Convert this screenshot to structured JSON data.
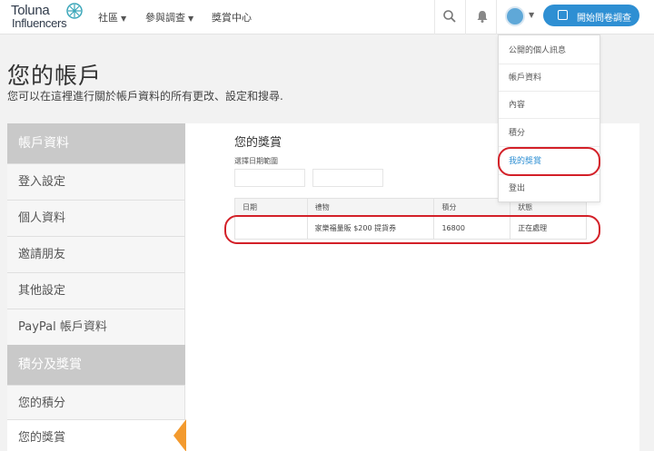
{
  "brand": {
    "logo_line1": "Toluna",
    "logo_line2": "Influencers"
  },
  "nav": {
    "items": [
      {
        "label": "社區",
        "has_dropdown": true
      },
      {
        "label": "參與調查",
        "has_dropdown": true
      },
      {
        "label": "獎賞中心",
        "has_dropdown": false
      }
    ],
    "start_button": "開始問卷調查"
  },
  "page": {
    "title": "您的帳戶",
    "subtitle": "您可以在這裡進行關於帳戶資料的所有更改、設定和搜尋."
  },
  "sidebar": {
    "sections": [
      {
        "heading": "帳戶資料",
        "items": [
          "登入設定",
          "個人資料",
          "邀請朋友",
          "其他設定",
          "PayPal 帳戶資料"
        ]
      },
      {
        "heading": "積分及獎賞",
        "items": [
          "您的積分",
          "您的獎賞"
        ]
      }
    ],
    "active_item": "您的獎賞"
  },
  "rewards": {
    "title": "您的獎賞",
    "date_range_label": "選擇日期範圍",
    "columns": [
      "日期",
      "禮物",
      "積分",
      "狀態"
    ],
    "rows": [
      {
        "date": "",
        "gift": "家樂福量販 $200 提貨券",
        "points": "16800",
        "status": "正在處理"
      }
    ]
  },
  "user_menu": {
    "items": [
      "公開的個人訊息",
      "帳戶資料",
      "內容",
      "積分",
      "我的獎賞",
      "登出"
    ],
    "selected": "我的獎賞"
  },
  "colors": {
    "accent": "#2e8fd3",
    "highlight": "#f39a2e",
    "annotation": "#d32028",
    "sidebar_heading": "#c9c9c9"
  }
}
